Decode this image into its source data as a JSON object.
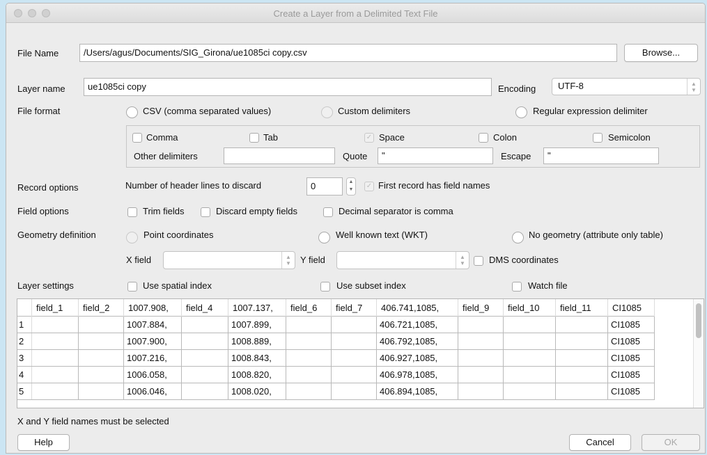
{
  "window": {
    "title": "Create a Layer from a Delimited Text File"
  },
  "file": {
    "label": "File Name",
    "value": "/Users/agus/Documents/SIG_Girona/ue1085ci copy.csv",
    "browse": "Browse..."
  },
  "layer": {
    "label": "Layer name",
    "value": "ue1085ci copy",
    "encoding_label": "Encoding",
    "encoding_value": "UTF-8"
  },
  "format": {
    "label": "File format",
    "csv": "CSV (comma separated values)",
    "custom": "Custom delimiters",
    "regex": "Regular expression delimiter",
    "comma": "Comma",
    "tab": "Tab",
    "space": "Space",
    "colon": "Colon",
    "semicolon": "Semicolon",
    "other_label": "Other delimiters",
    "other_value": "",
    "quote_label": "Quote",
    "quote_value": "\"",
    "escape_label": "Escape",
    "escape_value": "\""
  },
  "record": {
    "label": "Record options",
    "header_label": "Number of header lines to discard",
    "header_value": "0",
    "first_record": "First record has field names"
  },
  "fieldopts": {
    "label": "Field options",
    "trim": "Trim fields",
    "discard": "Discard empty fields",
    "decimal": "Decimal separator is comma"
  },
  "geometry": {
    "label": "Geometry definition",
    "point": "Point coordinates",
    "wkt": "Well known text (WKT)",
    "none": "No geometry (attribute only table)",
    "xfield": "X field",
    "yfield": "Y field",
    "dms": "DMS coordinates"
  },
  "settings": {
    "label": "Layer settings",
    "spatial": "Use spatial index",
    "subset": "Use subset index",
    "watch": "Watch file"
  },
  "table": {
    "headers": [
      "field_1",
      "field_2",
      "1007.908,",
      "field_4",
      "1007.137,",
      "field_6",
      "field_7",
      "406.741,1085,",
      "field_9",
      "field_10",
      "field_11",
      "CI1085"
    ],
    "rows": [
      [
        "1",
        "",
        "",
        "1007.884,",
        "",
        "1007.899,",
        "",
        "",
        "406.721,1085,",
        "",
        "",
        "",
        "CI1085"
      ],
      [
        "2",
        "",
        "",
        "1007.900,",
        "",
        "1008.889,",
        "",
        "",
        "406.792,1085,",
        "",
        "",
        "",
        "CI1085"
      ],
      [
        "3",
        "",
        "",
        "1007.216,",
        "",
        "1008.843,",
        "",
        "",
        "406.927,1085,",
        "",
        "",
        "",
        "CI1085"
      ],
      [
        "4",
        "",
        "",
        "1006.058,",
        "",
        "1008.820,",
        "",
        "",
        "406.978,1085,",
        "",
        "",
        "",
        "CI1085"
      ],
      [
        "5",
        "",
        "",
        "1006.046,",
        "",
        "1008.020,",
        "",
        "",
        "406.894,1085,",
        "",
        "",
        "",
        "CI1085"
      ]
    ]
  },
  "status": "X and Y field names must be selected",
  "buttons": {
    "help": "Help",
    "cancel": "Cancel",
    "ok": "OK"
  }
}
